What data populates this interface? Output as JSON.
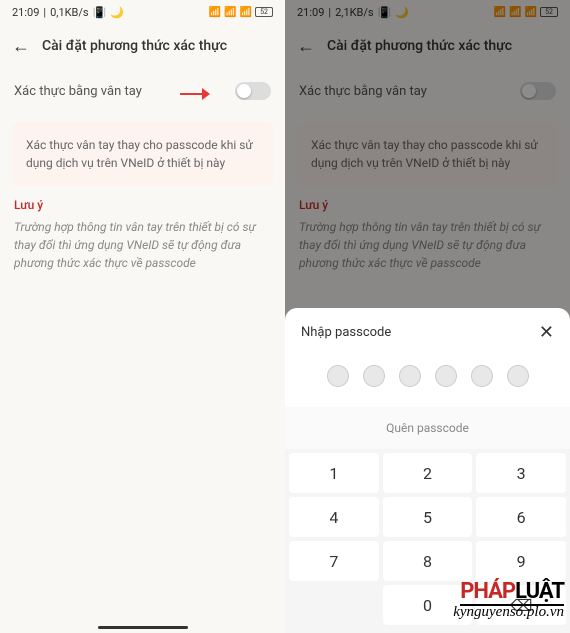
{
  "left": {
    "status": {
      "time": "21:09",
      "speed": "0,1KB/s",
      "battery": "52"
    },
    "header": {
      "title": "Cài đặt phương thức xác thực"
    },
    "toggle": {
      "label": "Xác thực bằng vân tay"
    },
    "info": "Xác thực vân tay thay cho passcode khi sử dụng dịch vụ trên VNeID ở thiết bị này",
    "note": {
      "title": "Lưu ý",
      "text": "Trường hợp thông tin vân tay trên thiết bị có sự thay đổi thì ứng dụng VNeID sẽ tự động đưa phương thức xác thực về passcode"
    }
  },
  "right": {
    "status": {
      "time": "21:09",
      "speed": "2,1KB/s",
      "battery": "52"
    },
    "header": {
      "title": "Cài đặt phương thức xác thực"
    },
    "toggle": {
      "label": "Xác thực bằng vân tay"
    },
    "info": "Xác thực vân tay thay cho passcode khi sử dụng dịch vụ trên VNeID ở thiết bị này",
    "note": {
      "title": "Lưu ý",
      "text": "Trường hợp thông tin vân tay trên thiết bị có sự thay đổi thì ứng dụng VNeID sẽ tự động đưa phương thức xác thực về passcode"
    },
    "modal": {
      "title": "Nhập passcode",
      "forgot": "Quên passcode"
    },
    "keys": [
      "1",
      "2",
      "3",
      "4",
      "5",
      "6",
      "7",
      "8",
      "9",
      "0"
    ]
  },
  "watermark": {
    "brand_red": "PHÁP",
    "brand_black": "LUẬT",
    "url": "kynguyenso.plo.vn"
  }
}
